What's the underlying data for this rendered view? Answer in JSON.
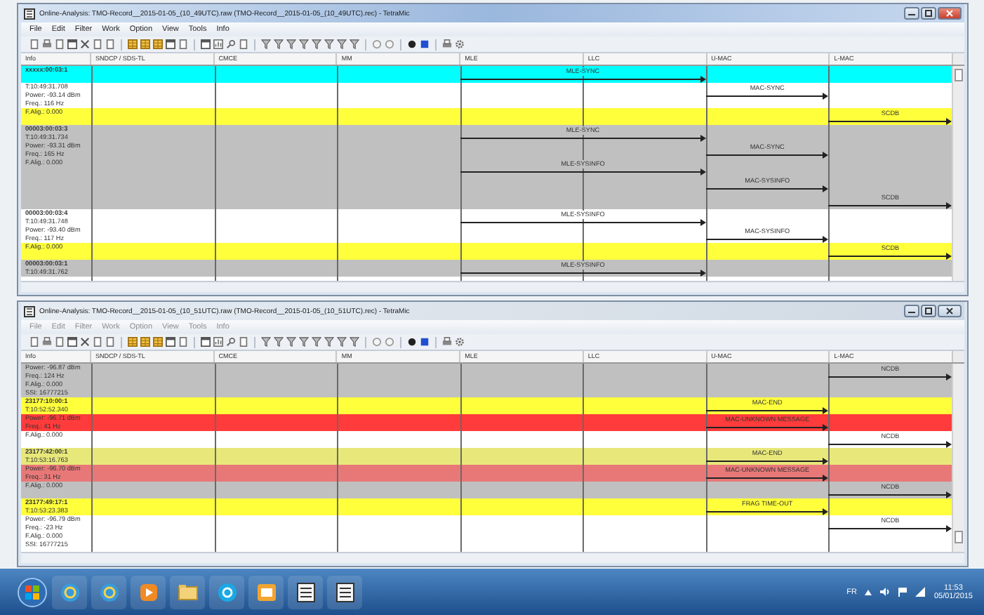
{
  "windows": [
    {
      "title": "Online-Analysis: TMO-Record__2015-01-05_(10_49UTC).raw (TMO-Record__2015-01-05_(10_49UTC).rec) - TetraMic",
      "active": true,
      "menu": [
        "File",
        "Edit",
        "Filter",
        "Work",
        "Option",
        "View",
        "Tools",
        "Info"
      ],
      "columns": [
        "Info",
        "SNDCP / SDS-TL",
        "CMCE",
        "MM",
        "MLE",
        "LLC",
        "U-MAC",
        "L-MAC"
      ],
      "bands": [
        {
          "color": "#00ffff",
          "id": "xxxxx:00:03:1",
          "events": [
            {
              "kind": "mle",
              "label": "MLE-SYNC"
            }
          ]
        },
        {
          "color": "#ffffff",
          "lines": [
            "T:10:49:31.708",
            "Power: -93.14 dBm",
            "Freq.: 116 Hz"
          ],
          "events": [
            {
              "kind": "umac",
              "label": "MAC-SYNC"
            }
          ]
        },
        {
          "color": "#ffff3c",
          "lines": [
            "F.Alig.: 0.000"
          ],
          "events": [
            {
              "kind": "lmac",
              "label": "SCDB"
            }
          ]
        },
        {
          "color": "#c0c0c0",
          "id": "00003:00:03:3",
          "lines": [
            "T:10:49:31.734",
            "Power: -93.31 dBm",
            "Freq.: 165 Hz",
            "F.Alig.: 0.000"
          ],
          "events": [
            {
              "kind": "mle",
              "label": "MLE-SYNC"
            },
            {
              "kind": "umac",
              "label": "MAC-SYNC"
            },
            {
              "kind": "mle",
              "label": "MLE-SYSINFO"
            },
            {
              "kind": "umac",
              "label": "MAC-SYSINFO"
            },
            {
              "kind": "lmac",
              "label": "SCDB"
            }
          ]
        },
        {
          "color": "#ffffff",
          "id": "00003:00:03:4",
          "lines": [
            "T:10:49:31.748",
            "Power: -93.40 dBm",
            "Freq.: 117 Hz"
          ],
          "events": [
            {
              "kind": "mle",
              "label": "MLE-SYSINFO"
            },
            {
              "kind": "umac",
              "label": "MAC-SYSINFO"
            }
          ]
        },
        {
          "color": "#ffff3c",
          "lines": [
            "F.Alig.: 0.000"
          ],
          "events": [
            {
              "kind": "lmac",
              "label": "SCDB"
            }
          ]
        },
        {
          "color": "#c0c0c0",
          "id": "00003:00:03:1",
          "lines": [
            "T:10:49:31.762"
          ],
          "events": [
            {
              "kind": "mle",
              "label": "MLE-SYSINFO"
            }
          ]
        }
      ]
    },
    {
      "title": "Online-Analysis: TMO-Record__2015-01-05_(10_51UTC).raw (TMO-Record__2015-01-05_(10_51UTC).rec) - TetraMic",
      "active": false,
      "menu": [
        "File",
        "Edit",
        "Filter",
        "Work",
        "Option",
        "View",
        "Tools",
        "Info"
      ],
      "columns": [
        "Info",
        "SNDCP / SDS-TL",
        "CMCE",
        "MM",
        "MLE",
        "LLC",
        "U-MAC",
        "L-MAC"
      ],
      "bands": [
        {
          "color": "#c0c0c0",
          "lines": [
            "Power: -96.87 dBm",
            "Freq.: 124 Hz",
            "F.Alig.: 0.000",
            "SSI: 16777215"
          ],
          "events": [
            {
              "kind": "lmac",
              "label": "NCDB"
            }
          ]
        },
        {
          "color": "#ffff3c",
          "id": "23177:10:00:1",
          "lines": [
            "T:10:52:52.340"
          ],
          "events": [
            {
              "kind": "umac",
              "label": "MAC-END"
            }
          ]
        },
        {
          "color": "#ff3b3b",
          "lines": [
            "Power: -96.71 dBm",
            "Freq.: 41 Hz"
          ],
          "events": [
            {
              "kind": "umac",
              "label": "MAC-UNKNOWN MESSAGE"
            }
          ]
        },
        {
          "color": "#ffffff",
          "lines": [
            "F.Alig.: 0.000"
          ],
          "events": [
            {
              "kind": "lmac",
              "label": "NCDB"
            }
          ]
        },
        {
          "color": "#e8e87a",
          "id": "23177:42:00:1",
          "lines": [
            "T:10:53:16.763"
          ],
          "events": [
            {
              "kind": "umac",
              "label": "MAC-END"
            }
          ]
        },
        {
          "color": "#e87878",
          "lines": [
            "Power: -96.70 dBm",
            "Freq.: 31 Hz"
          ],
          "events": [
            {
              "kind": "umac",
              "label": "MAC-UNKNOWN MESSAGE"
            }
          ]
        },
        {
          "color": "#c0c0c0",
          "lines": [
            "F.Alig.: 0.000"
          ],
          "events": [
            {
              "kind": "lmac",
              "label": "NCDB"
            }
          ]
        },
        {
          "color": "#ffff3c",
          "id": "23177:49:17:1",
          "lines": [
            "T:10:53:23.383"
          ],
          "events": [
            {
              "kind": "umac",
              "label": "FRAG TIME-OUT"
            }
          ]
        },
        {
          "color": "#ffffff",
          "lines": [
            "Power: -96.79 dBm",
            "Freq.: -23 Hz",
            "F.Alig.: 0.000",
            "SSI: 16777215"
          ],
          "events": [
            {
              "kind": "lmac",
              "label": "NCDB"
            }
          ]
        }
      ]
    }
  ],
  "taskbar": {
    "language": "FR",
    "time": "11:53",
    "date": "05/01/2015"
  }
}
